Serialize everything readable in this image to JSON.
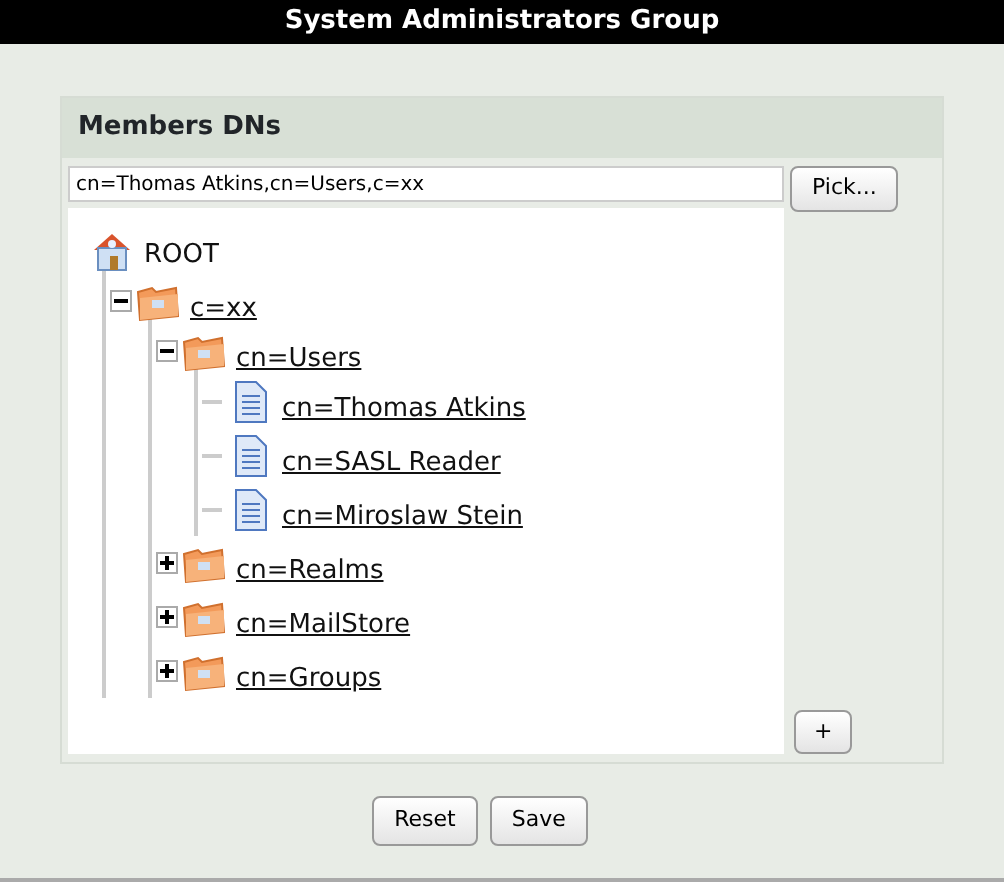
{
  "window": {
    "title": "System Administrators Group"
  },
  "panel": {
    "title": "Members DNs",
    "field": {
      "value": "cn=Thomas Atkins,cn=Users,c=xx"
    },
    "pick_button": "Pick...",
    "add_button": "+",
    "tree": {
      "label": "ROOT",
      "kind": "home",
      "children": [
        {
          "label": "c=xx",
          "kind": "folder",
          "expanded": true,
          "children": [
            {
              "label": "cn=Users",
              "kind": "folder",
              "expanded": true,
              "children": [
                {
                  "label": "cn=Thomas Atkins",
                  "kind": "entry"
                },
                {
                  "label": "cn=SASL Reader",
                  "kind": "entry"
                },
                {
                  "label": "cn=Miroslaw Stein",
                  "kind": "entry"
                }
              ]
            },
            {
              "label": "cn=Realms",
              "kind": "folder",
              "expanded": false
            },
            {
              "label": "cn=MailStore",
              "kind": "folder",
              "expanded": false
            },
            {
              "label": "cn=Groups",
              "kind": "folder",
              "expanded": false
            }
          ]
        }
      ]
    }
  },
  "buttons": [
    "Reset",
    "Save"
  ]
}
